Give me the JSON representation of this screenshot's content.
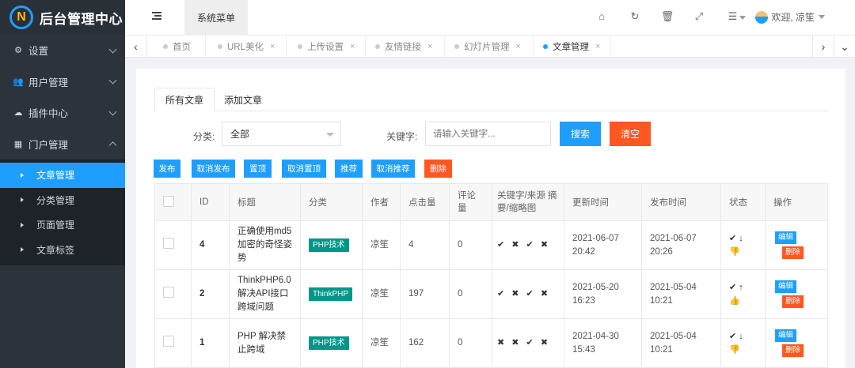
{
  "brand": {
    "title": "后台管理中心",
    "logo_letter": "N",
    "logo_icon": "brand-logo-icon"
  },
  "sidebar": {
    "groups": [
      {
        "label": "设置",
        "icon": "gear-icon"
      },
      {
        "label": "用户管理",
        "icon": "users-icon"
      },
      {
        "label": "插件中心",
        "icon": "cloud-icon"
      },
      {
        "label": "门户管理",
        "icon": "grid-icon"
      }
    ],
    "subitems": [
      {
        "label": "文章管理",
        "active": true
      },
      {
        "label": "分类管理"
      },
      {
        "label": "页面管理"
      },
      {
        "label": "文章标签"
      }
    ]
  },
  "header": {
    "system_menu": "系统菜单",
    "icons": [
      "home-icon",
      "refresh-icon",
      "trash-icon",
      "fullscreen-icon",
      "menu-icon"
    ],
    "greeting": "欢迎, 凉笙"
  },
  "tabs": [
    {
      "label": "首页",
      "closable": false
    },
    {
      "label": "URL美化",
      "closable": true
    },
    {
      "label": "上传设置",
      "closable": true
    },
    {
      "label": "友情链接",
      "closable": true
    },
    {
      "label": "幻灯片管理",
      "closable": true
    },
    {
      "label": "文章管理",
      "closable": true,
      "active": true
    }
  ],
  "tab_close": "×",
  "page": {
    "subtabs": [
      "所有文章",
      "添加文章"
    ],
    "filter": {
      "category_label": "分类:",
      "category_value": "全部",
      "keyword_label": "关键字:",
      "keyword_placeholder": "请输入关键字...",
      "search": "搜索",
      "clear": "清空"
    },
    "actions": [
      "发布",
      "取消发布",
      "置顶",
      "取消置顶",
      "推荐",
      "取消推荐",
      "删除"
    ],
    "table": {
      "headers": [
        "ID",
        "标题",
        "分类",
        "作者",
        "点击量",
        "评论量",
        "关键字/来源 摘要/缩略图",
        "更新时间",
        "发布时间",
        "状态",
        "操作"
      ],
      "rows": [
        {
          "id": "4",
          "title": "正确使用md5加密的奇怪姿势",
          "category": "PHP技术",
          "author": "凉笙",
          "views": "4",
          "comments": "0",
          "marks": "✔ ✖ ✔ ✖",
          "updated": "2021-06-07 20:42",
          "published": "2021-06-07 20:26",
          "state1": "✔ ↓",
          "state2": "👎"
        },
        {
          "id": "2",
          "title": "ThinkPHP6.0解决API接口跨域问题",
          "category": "ThinkPHP",
          "author": "凉笙",
          "views": "197",
          "comments": "0",
          "marks": "✔ ✖ ✔ ✖",
          "updated": "2021-05-20 16:23",
          "published": "2021-05-04 10:21",
          "state1": "✔ ↑",
          "state2": "👍"
        },
        {
          "id": "1",
          "title": "PHP 解决禁止跨域",
          "category": "PHP技术",
          "author": "凉笙",
          "views": "162",
          "comments": "0",
          "marks": "✖ ✖ ✔ ✖",
          "updated": "2021-04-30 15:43",
          "published": "2021-05-04 10:21",
          "state1": "✔ ↓",
          "state2": "👎"
        }
      ],
      "edit": "编辑",
      "delete": "删除"
    }
  }
}
